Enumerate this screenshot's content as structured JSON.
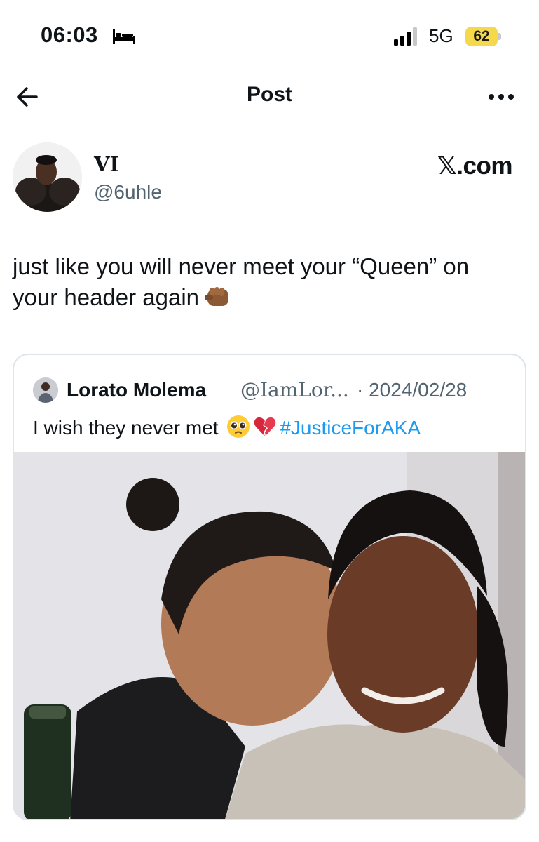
{
  "status_bar": {
    "time": "06:03",
    "sleep_icon": "bed-icon",
    "network": "5G",
    "battery": "62",
    "battery_color": "#f5d94a"
  },
  "header": {
    "title": "Post",
    "back_icon": "arrow-left-icon",
    "more_icon": "more-icon"
  },
  "author": {
    "name": "VI",
    "handle": "@6uhle",
    "source": "𝕏.com"
  },
  "tweet": {
    "text": "just like you will never meet your “Queen” on your header again",
    "emoji": "fist-emoji"
  },
  "quote": {
    "name": "Lorato Molema",
    "handle": "@IamLor...",
    "date": "· 2024/02/28",
    "text": "I wish they never met",
    "emojis": [
      "pleading-face-emoji",
      "broken-heart-emoji"
    ],
    "hashtag": "#JusticeForAKA",
    "hashtag_color": "#1d9bf0"
  }
}
